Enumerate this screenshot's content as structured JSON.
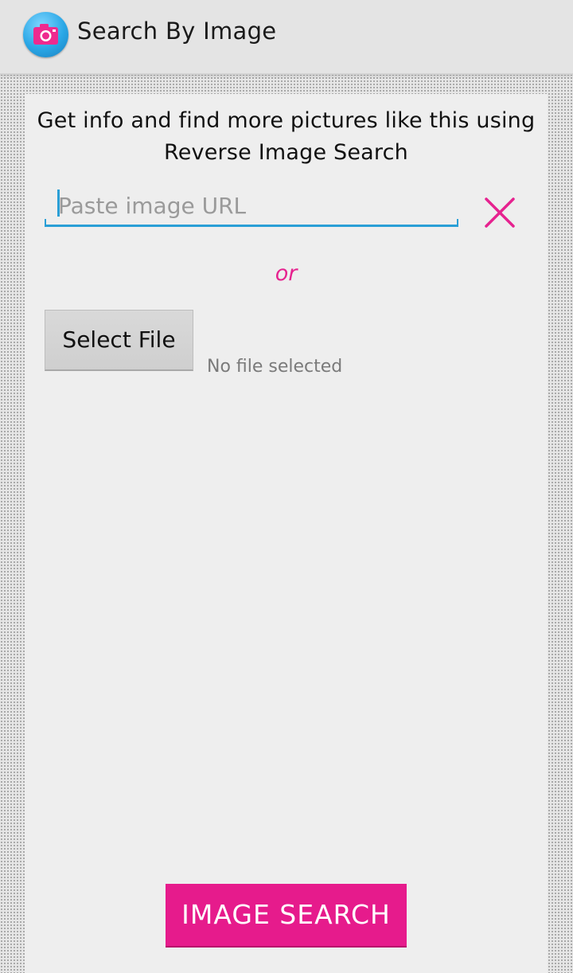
{
  "app": {
    "title": "Search By Image",
    "icon": "camera-icon"
  },
  "intro": {
    "text": "Get info and find more pictures like this using Reverse Image Search"
  },
  "url_input": {
    "placeholder": "Paste image URL",
    "value": ""
  },
  "clear_button": {
    "icon": "close-icon"
  },
  "divider": {
    "text": "or"
  },
  "file_picker": {
    "button_label": "Select File",
    "status": "No file selected"
  },
  "search_button": {
    "label": "IMAGE SEARCH"
  },
  "colors": {
    "accent": "#e61b8c",
    "input_underline": "#2a9fd6",
    "app_icon": "#2aa7e6"
  }
}
